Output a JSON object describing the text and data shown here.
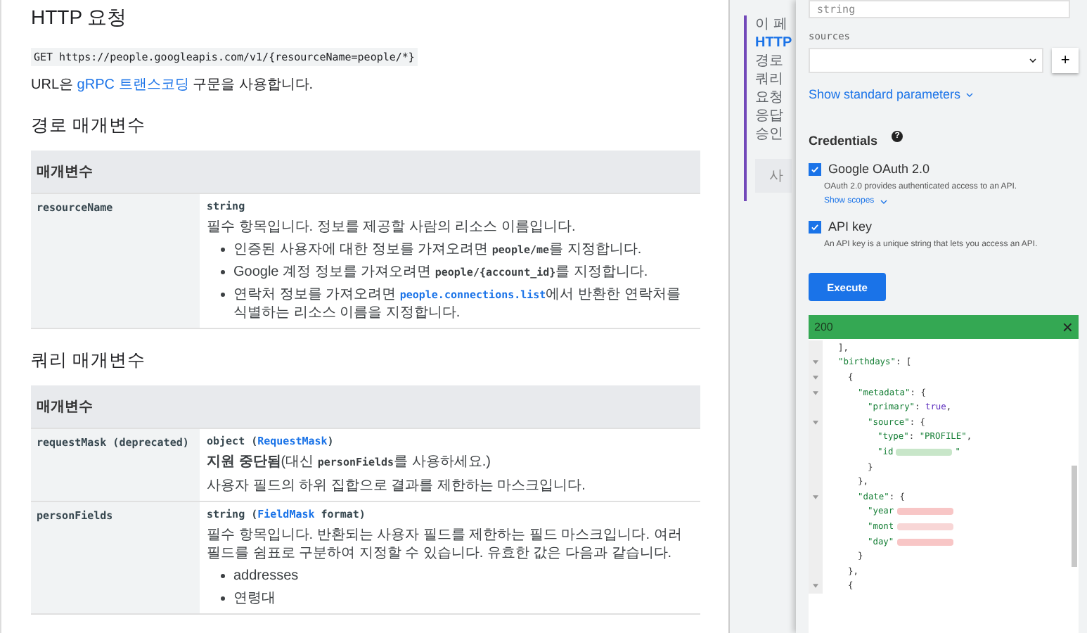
{
  "main": {
    "http_title": "HTTP 요청",
    "http_line": "GET https://people.googleapis.com/v1/{resourceName=people/*}",
    "url_note": [
      {
        "text": "URL은 ",
        "kind": "plain"
      },
      {
        "text": "gRPC 트랜스코딩",
        "kind": "link"
      },
      {
        "text": " 구문을 사용합니다.",
        "kind": "plain"
      }
    ],
    "sections": [
      {
        "title": "경로 매개변수",
        "table": {
          "header": "매개변수",
          "rows": [
            {
              "name": "resourceName",
              "blocks": [
                {
                  "kind": "type",
                  "parts": [
                    {
                      "text": "string",
                      "kind": "code"
                    }
                  ]
                },
                {
                  "kind": "para",
                  "parts": [
                    {
                      "text": "필수 항목입니다. 정보를 제공할 사람의 리소스 이름입니다.",
                      "kind": "plain"
                    }
                  ]
                },
                {
                  "kind": "bullets",
                  "items": [
                    [
                      {
                        "text": "인증된 사용자에 대한 정보를 가져오려면 ",
                        "kind": "plain"
                      },
                      {
                        "text": "people/me",
                        "kind": "code"
                      },
                      {
                        "text": "를 지정합니다.",
                        "kind": "plain"
                      }
                    ],
                    [
                      {
                        "text": "Google 계정 정보를 가져오려면 ",
                        "kind": "plain"
                      },
                      {
                        "text": "people/{account_id}",
                        "kind": "code"
                      },
                      {
                        "text": "를 지정합니다.",
                        "kind": "plain"
                      }
                    ],
                    [
                      {
                        "text": "연락처 정보를 가져오려면 ",
                        "kind": "plain"
                      },
                      {
                        "text": "people.connections.list",
                        "kind": "codelink"
                      },
                      {
                        "text": "에서 반환한 연락처를 식별하는 리소스 이름을 지정합니다.",
                        "kind": "plain"
                      }
                    ]
                  ]
                }
              ]
            }
          ]
        }
      },
      {
        "title": "쿼리 매개변수",
        "table": {
          "header": "매개변수",
          "rows": [
            {
              "name": "requestMask (deprecated)",
              "blocks": [
                {
                  "kind": "type",
                  "parts": [
                    {
                      "text": "object (",
                      "kind": "code"
                    },
                    {
                      "text": "RequestMask",
                      "kind": "codelink"
                    },
                    {
                      "text": ")",
                      "kind": "code"
                    }
                  ]
                },
                {
                  "kind": "para",
                  "parts": [
                    {
                      "text": "지원 중단됨",
                      "kind": "bold"
                    },
                    {
                      "text": "(대신 ",
                      "kind": "plain"
                    },
                    {
                      "text": "personFields",
                      "kind": "code"
                    },
                    {
                      "text": "를 사용하세요.)",
                      "kind": "plain"
                    }
                  ]
                },
                {
                  "kind": "para",
                  "parts": [
                    {
                      "text": "사용자 필드의 하위 집합으로 결과를 제한하는 마스크입니다.",
                      "kind": "plain"
                    }
                  ]
                }
              ]
            },
            {
              "name": "personFields",
              "blocks": [
                {
                  "kind": "type",
                  "parts": [
                    {
                      "text": "string (",
                      "kind": "code"
                    },
                    {
                      "text": "FieldMask",
                      "kind": "codelink"
                    },
                    {
                      "text": " format)",
                      "kind": "code"
                    }
                  ]
                },
                {
                  "kind": "para",
                  "parts": [
                    {
                      "text": "필수 항목입니다. 반환되는 사용자 필드를 제한하는 필드 마스크입니다. 여러 필드를 쉼표로 구분하여 지정할 수 있습니다. 유효한 값은 다음과 같습니다.",
                      "kind": "plain"
                    }
                  ]
                },
                {
                  "kind": "bullets",
                  "items": [
                    [
                      {
                        "text": "addresses",
                        "kind": "plain"
                      }
                    ],
                    [
                      {
                        "text": "연령대",
                        "kind": "plain"
                      }
                    ]
                  ]
                }
              ]
            }
          ]
        }
      }
    ]
  },
  "toc": {
    "items": [
      {
        "label": "이 페",
        "selected": false
      },
      {
        "label": "HTTP",
        "selected": true
      },
      {
        "label": "경로",
        "selected": false
      },
      {
        "label": "쿼리",
        "selected": false
      },
      {
        "label": "요청",
        "selected": false
      },
      {
        "label": "응답",
        "selected": false
      },
      {
        "label": "승인",
        "selected": false
      }
    ],
    "button": "사"
  },
  "panel": {
    "top_field": {
      "placeholder": "string"
    },
    "sources": {
      "label": "sources",
      "add": "+"
    },
    "standard_params": "Show standard parameters",
    "credentials": {
      "title": "Credentials",
      "help": "?",
      "options": [
        {
          "label": "Google OAuth 2.0",
          "checked": true,
          "description": "OAuth 2.0 provides authenticated access to an API.",
          "link": "Show scopes"
        },
        {
          "label": "API key",
          "checked": true,
          "description": "An API key is a unique string that lets you access an API."
        }
      ]
    },
    "execute": "Execute",
    "response": {
      "status": "200",
      "close": "×",
      "lines": [
        {
          "fold": false,
          "parts": [
            {
              "text": "],",
              "kind": "punct"
            }
          ]
        },
        {
          "fold": true,
          "parts": [
            {
              "text": "\"birthdays\"",
              "kind": "key"
            },
            {
              "text": ": [",
              "kind": "punct"
            }
          ]
        },
        {
          "fold": true,
          "parts": [
            {
              "text": "{",
              "kind": "punct"
            }
          ]
        },
        {
          "fold": true,
          "parts": [
            {
              "text": "\"metadata\"",
              "kind": "key"
            },
            {
              "text": ": {",
              "kind": "punct"
            }
          ]
        },
        {
          "fold": false,
          "parts": [
            {
              "text": "\"primary\"",
              "kind": "key"
            },
            {
              "text": ": ",
              "kind": "punct"
            },
            {
              "text": "true",
              "kind": "bool"
            },
            {
              "text": ",",
              "kind": "punct"
            }
          ]
        },
        {
          "fold": true,
          "parts": [
            {
              "text": "\"source\"",
              "kind": "key"
            },
            {
              "text": ": {",
              "kind": "punct"
            }
          ]
        },
        {
          "fold": false,
          "parts": [
            {
              "text": "\"type\"",
              "kind": "key"
            },
            {
              "text": ": ",
              "kind": "punct"
            },
            {
              "text": "\"PROFILE\"",
              "kind": "string"
            },
            {
              "text": ",",
              "kind": "punct"
            }
          ]
        },
        {
          "fold": false,
          "parts": [
            {
              "text": "\"id",
              "kind": "key"
            },
            {
              "kind": "redacted",
              "color": "#c8e6c9"
            },
            {
              "text": "\"",
              "kind": "string"
            }
          ]
        },
        {
          "fold": false,
          "parts": [
            {
              "text": "}",
              "kind": "punct"
            }
          ]
        },
        {
          "fold": false,
          "parts": [
            {
              "text": "},",
              "kind": "punct"
            }
          ]
        },
        {
          "fold": true,
          "parts": [
            {
              "text": "\"date\"",
              "kind": "key"
            },
            {
              "text": ": {",
              "kind": "punct"
            }
          ]
        },
        {
          "fold": false,
          "parts": [
            {
              "text": "\"year",
              "kind": "key"
            },
            {
              "kind": "redacted",
              "color": "#f8c6c6"
            }
          ]
        },
        {
          "fold": false,
          "parts": [
            {
              "text": "\"mont",
              "kind": "key"
            },
            {
              "kind": "redacted",
              "color": "#f8d6d6"
            }
          ]
        },
        {
          "fold": false,
          "parts": [
            {
              "text": "\"day\"",
              "kind": "key"
            },
            {
              "kind": "redacted",
              "color": "#f8c6c6"
            }
          ]
        },
        {
          "fold": false,
          "parts": [
            {
              "text": "}",
              "kind": "punct"
            }
          ]
        },
        {
          "fold": false,
          "parts": [
            {
              "text": "},",
              "kind": "punct"
            }
          ]
        },
        {
          "fold": true,
          "parts": [
            {
              "text": "{",
              "kind": "punct"
            }
          ]
        }
      ]
    }
  }
}
